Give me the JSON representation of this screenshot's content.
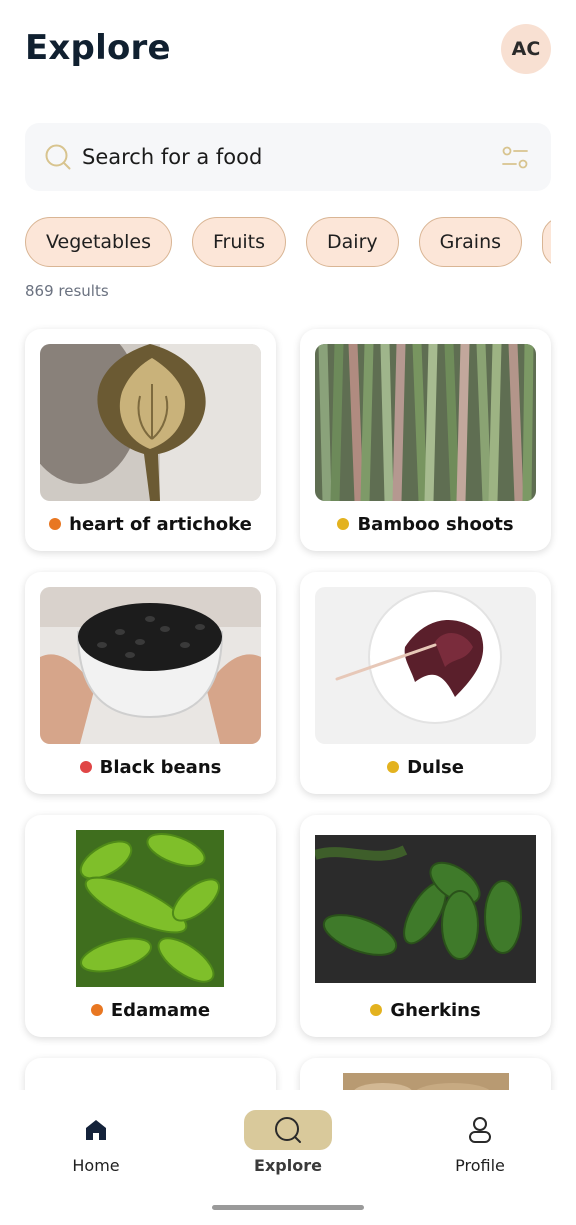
{
  "header": {
    "title": "Explore",
    "avatar_initials": "AC"
  },
  "search": {
    "placeholder": "Search for a food",
    "icon": "search-icon",
    "filter_icon": "sliders-icon"
  },
  "chips": [
    "Vegetables",
    "Fruits",
    "Dairy",
    "Grains"
  ],
  "results_text": "869 results",
  "colors": {
    "orange": "#e87722",
    "yellow": "#e3b21f",
    "red": "#e04646",
    "chip_bg": "#fce6d8",
    "chip_border": "#d9b594",
    "nav_active": "#d9c99b",
    "avatar_bg": "#f8e0d2"
  },
  "foods": [
    {
      "name": "heart of artichoke",
      "dot": "orange",
      "image": "artichoke"
    },
    {
      "name": "Bamboo shoots",
      "dot": "yellow",
      "image": "bamboo"
    },
    {
      "name": "Black beans",
      "dot": "red",
      "image": "black-beans"
    },
    {
      "name": "Dulse",
      "dot": "yellow",
      "image": "dulse"
    },
    {
      "name": "Edamame",
      "dot": "orange",
      "image": "edamame"
    },
    {
      "name": "Gherkins",
      "dot": "yellow",
      "image": "gherkins"
    }
  ],
  "nav": [
    {
      "label": "Home",
      "icon": "home-icon",
      "active": false
    },
    {
      "label": "Explore",
      "icon": "search-icon",
      "active": true
    },
    {
      "label": "Profile",
      "icon": "user-icon",
      "active": false
    }
  ]
}
